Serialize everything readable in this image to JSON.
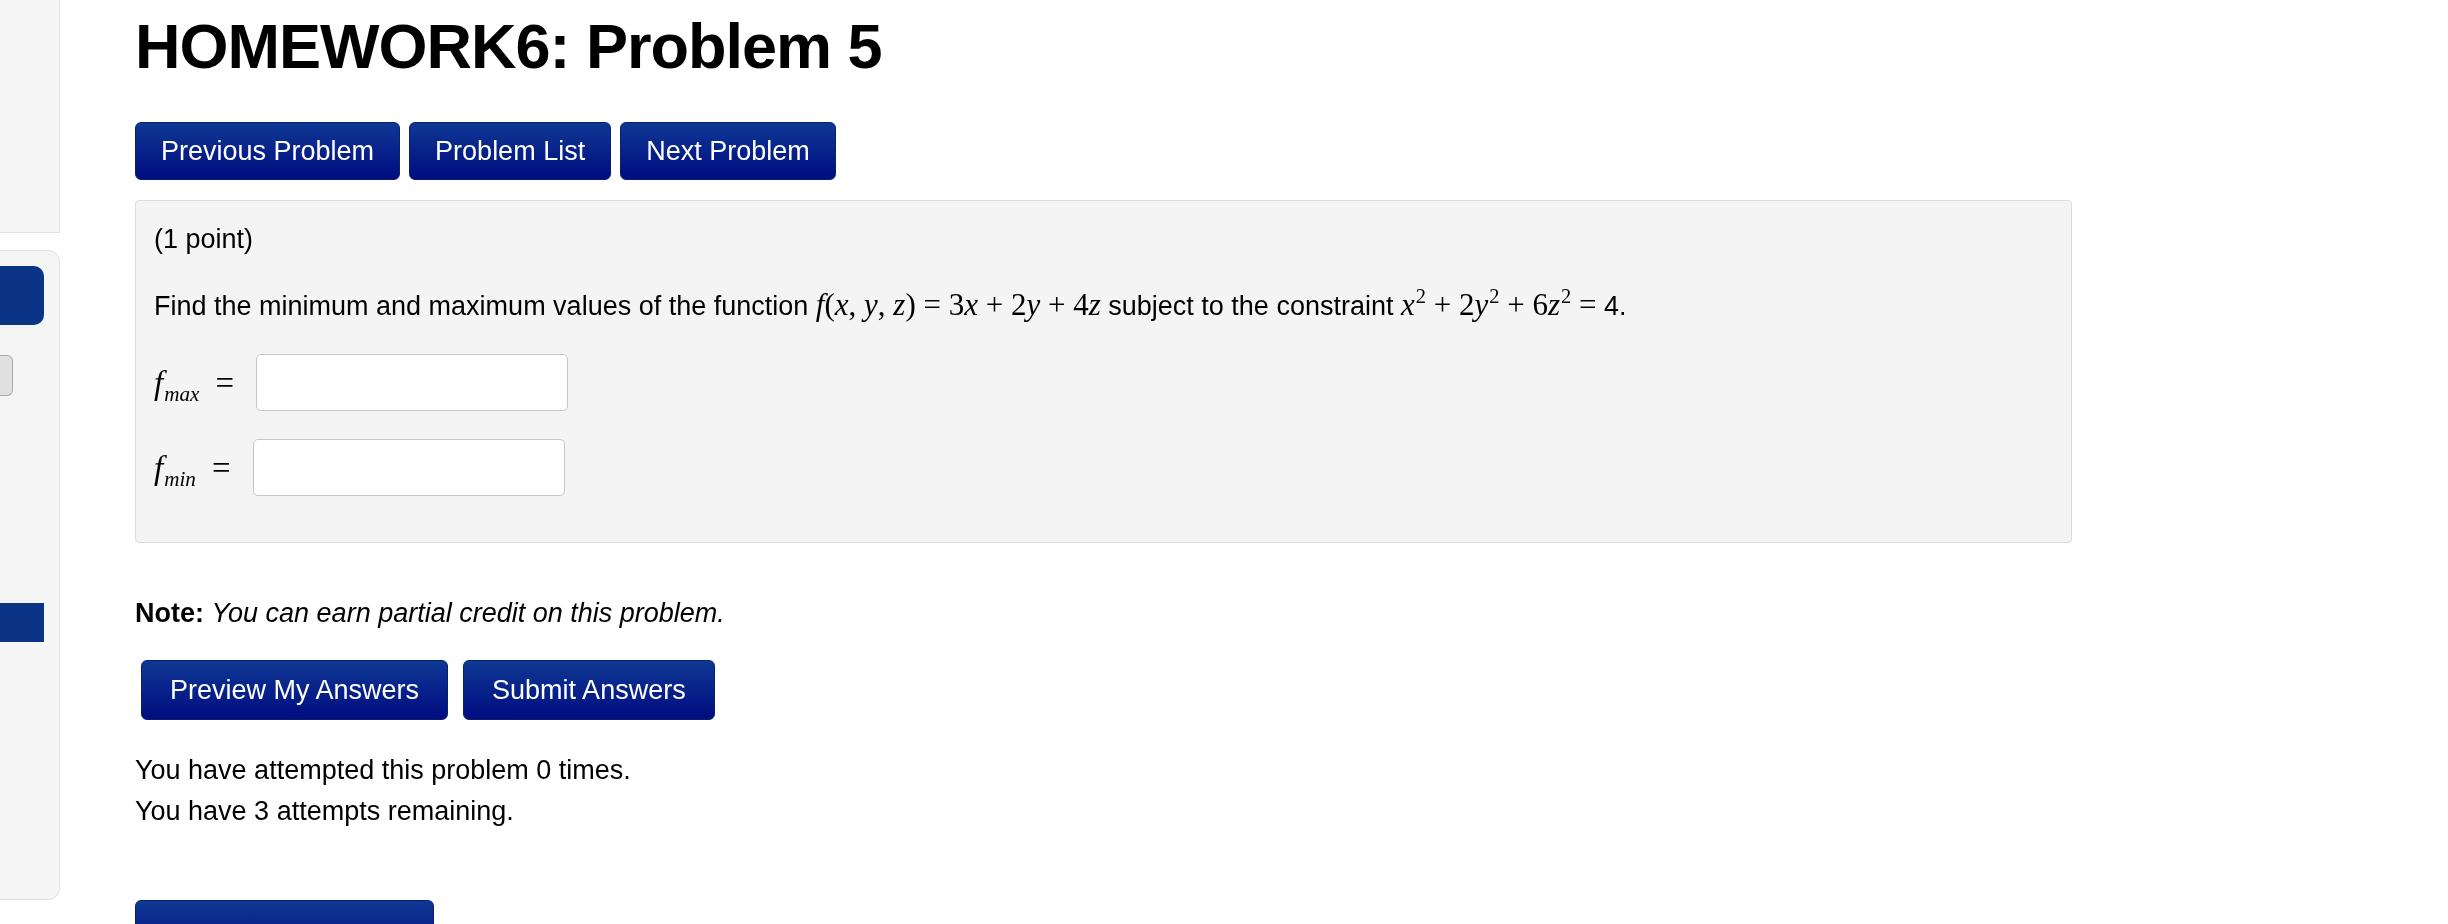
{
  "page": {
    "title": "HOMEWORK6: Problem 5"
  },
  "sidebar": {
    "items": [
      {
        "kind": "pill"
      },
      {
        "kind": "toggle"
      },
      {
        "kind": "bar"
      }
    ]
  },
  "nav_buttons": [
    "Previous Problem",
    "Problem List",
    "Next Problem"
  ],
  "problem": {
    "points": "(1 point)",
    "statement": [
      {
        "kind": "text",
        "text": "Find the minimum and maximum values of the function"
      },
      {
        "kind": "math",
        "text": "f(x, y, z) = 3x + 2y + 4z"
      },
      {
        "kind": "text",
        "text": "subject to the constraint"
      },
      {
        "kind": "math",
        "text": "x$^{2}$ + 2y$^{2}$ + 6z$^{2}$ ="
      },
      {
        "kind": "text",
        "text": "4."
      }
    ],
    "answers": [
      {
        "label": "f$_{max}$ ="
      },
      {
        "label": "f$_{min}$ ="
      }
    ]
  },
  "note": "**Note:** *You can earn partial credit on this problem.*",
  "submit_buttons": [
    "Preview My Answers",
    "Submit Answers"
  ],
  "attempts": [
    "You have attempted this problem 0 times.",
    "You have 3 attempts remaining."
  ],
  "footer_button": {
    "kind": "cut-off"
  }
}
